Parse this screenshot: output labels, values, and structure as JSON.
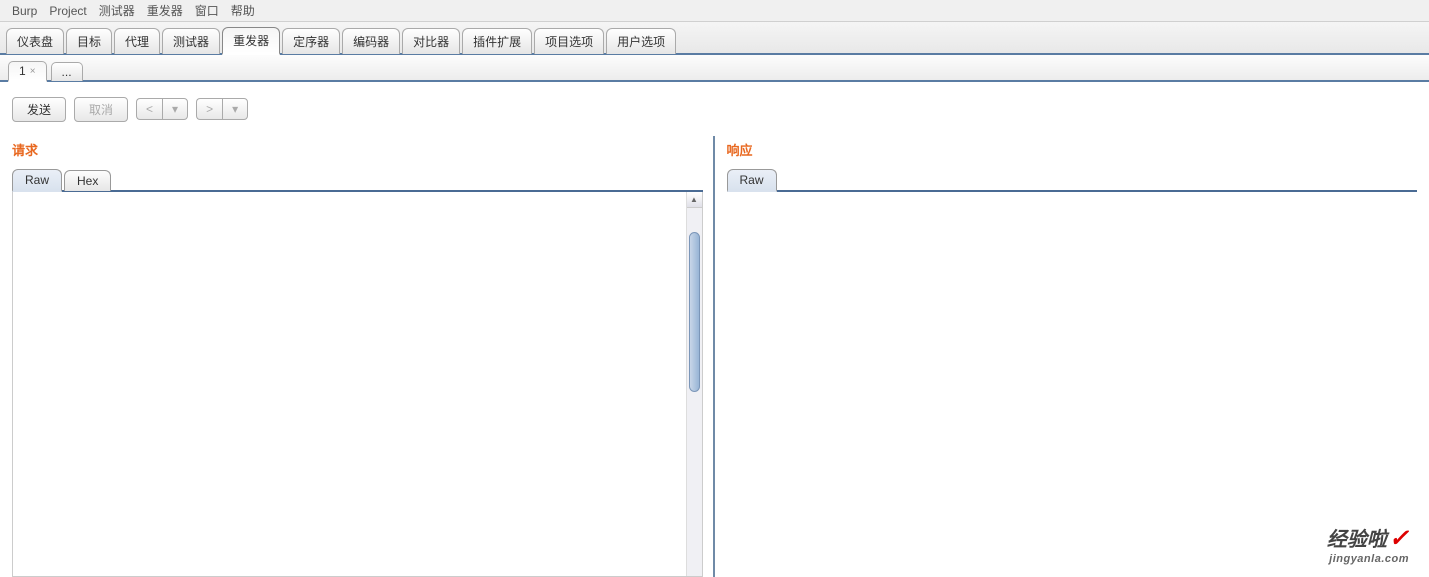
{
  "menubar": [
    "Burp",
    "Project",
    "测试器",
    "重发器",
    "窗口",
    "帮助"
  ],
  "main_tabs": {
    "items": [
      "仪表盘",
      "目标",
      "代理",
      "测试器",
      "重发器",
      "定序器",
      "编码器",
      "对比器",
      "插件扩展",
      "项目选项",
      "用户选项"
    ],
    "active_index": 4
  },
  "sub_tabs": {
    "items": [
      {
        "label": "1",
        "closable": true
      },
      {
        "label": "...",
        "closable": false
      }
    ],
    "active_index": 0
  },
  "toolbar": {
    "send": "发送",
    "cancel": "取消",
    "prev": "<",
    "next": ">",
    "drop_marker": "▾"
  },
  "request": {
    "title": "请求",
    "tabs": [
      "Raw",
      "Hex"
    ],
    "active_index": 0
  },
  "response": {
    "title": "响应",
    "tabs": [
      "Raw"
    ],
    "active_index": 0
  },
  "watermark": {
    "brand": "经验啦",
    "check": "✓",
    "url": "jingyanla.com"
  }
}
